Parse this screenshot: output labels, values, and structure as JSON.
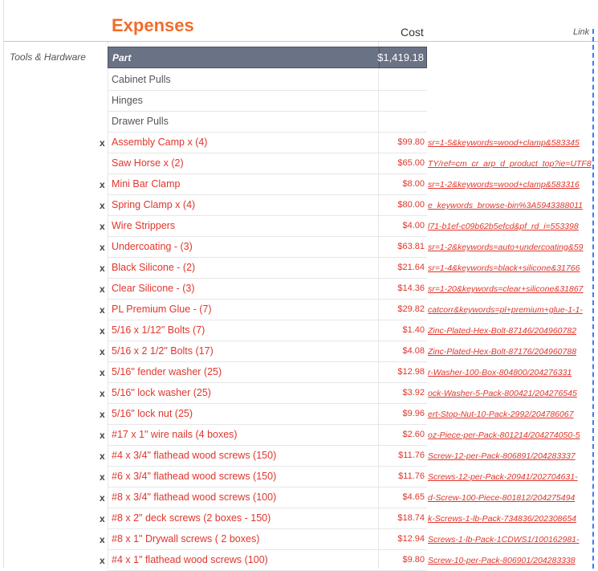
{
  "header": {
    "title": "Expenses",
    "cost": "Cost",
    "link": "Link"
  },
  "category": "Tools & Hardware",
  "part_header": {
    "label": "Part",
    "total": "$1,419.18"
  },
  "plain_items": [
    "Cabinet Pulls",
    "Hinges",
    "Drawer Pulls"
  ],
  "items": [
    {
      "mark": "x",
      "name": "Assembly Camp x (4)",
      "cost": "$99.80",
      "link": "583345&sr=1-5&keywords=wood+clamp"
    },
    {
      "mark": "",
      "name": "Saw Horse x (2)",
      "cost": "$65.00",
      "link": "TY/ref=cm_cr_arp_d_product_top?ie=UTF8"
    },
    {
      "mark": "x",
      "name": "Mini Bar Clamp",
      "cost": "$8.00",
      "link": "583316&sr=1-2&keywords=wood+clamp"
    },
    {
      "mark": "x",
      "name": "Spring Clamp x (4)",
      "cost": "$80.00",
      "link": "e_keywords_browse-bin%3A5943388011"
    },
    {
      "mark": "x",
      "name": "Wire Strippers",
      "cost": "$4.00",
      "link": "l71-b1ef-c09b62b5efcd&pf_rd_i=553398"
    },
    {
      "mark": "x",
      "name": "Undercoating - (3)",
      "cost": "$63.81",
      "link": "59&sr=1-2&keywords=auto+undercoating"
    },
    {
      "mark": "x",
      "name": "Black Silicone - (2)",
      "cost": "$21.64",
      "link": "31766&sr=1-4&keywords=black+silicone"
    },
    {
      "mark": "x",
      "name": "Clear Silicone - (3)",
      "cost": "$14.36",
      "link": "31867&sr=1-20&keywords=clear+silicone"
    },
    {
      "mark": "x",
      "name": "PL Premium Glue - (7)",
      "cost": "$29.82",
      "link": "-1-1-catcorr&keywords=pl+premium+glue"
    },
    {
      "mark": "x",
      "name": "5/16 x 1/12\" Bolts (7)",
      "cost": "$1.40",
      "link": "Zinc-Plated-Hex-Bolt-87146/204960782"
    },
    {
      "mark": "x",
      "name": "5/16 x 2 1/2\" Bolts (17)",
      "cost": "$4.08",
      "link": "Zinc-Plated-Hex-Bolt-87176/204960788"
    },
    {
      "mark": "x",
      "name": "5/16\" fender washer (25)",
      "cost": "$12.98",
      "link": "r-Washer-100-Box-804800/204276331"
    },
    {
      "mark": "x",
      "name": "5/16\" lock washer (25)",
      "cost": "$3.92",
      "link": "ock-Washer-5-Pack-800421/204276545"
    },
    {
      "mark": "x",
      "name": "5/16\" lock nut (25)",
      "cost": "$9.96",
      "link": "ert-Stop-Nut-10-Pack-2992/204786067"
    },
    {
      "mark": "x",
      "name": "#17 x 1\" wire nails (4 boxes)",
      "cost": "$2.60",
      "link": "5-oz-Piece-per-Pack-801214/204274050"
    },
    {
      "mark": "x",
      "name": "#4 x 3/4\" flathead wood screws (150)",
      "cost": "$11.76",
      "link": "Screw-12-per-Pack-806891/204283337"
    },
    {
      "mark": "x",
      "name": "#6 x 3/4\" flathead wood screws (150)",
      "cost": "$11.76",
      "link": "-Screws-12-per-Pack-20941/202704631"
    },
    {
      "mark": "x",
      "name": "#8 x 3/4\" flathead wood screws (100)",
      "cost": "$4.65",
      "link": "d-Screw-100-Piece-801812/204275494"
    },
    {
      "mark": "x",
      "name": "#8 x 2\" deck screws (2 boxes - 150)",
      "cost": "$18.74",
      "link": "k-Screws-1-lb-Pack-734836/202308654"
    },
    {
      "mark": "x",
      "name": "#8 x  1\" Drywall screws ( 2 boxes)",
      "cost": "$12.94",
      "link": "-Screws-1-lb-Pack-1CDWS1/100162981"
    },
    {
      "mark": "x",
      "name": "#4 x 1\" flathead wood screws (100)",
      "cost": "$9.80",
      "link": "Screw-10-per-Pack-806901/204283338"
    }
  ],
  "colors": {
    "accent": "#f26b2b",
    "item_red": "#e0362c",
    "header_bg": "#6a7285",
    "selection_dash": "#3b7bff"
  }
}
